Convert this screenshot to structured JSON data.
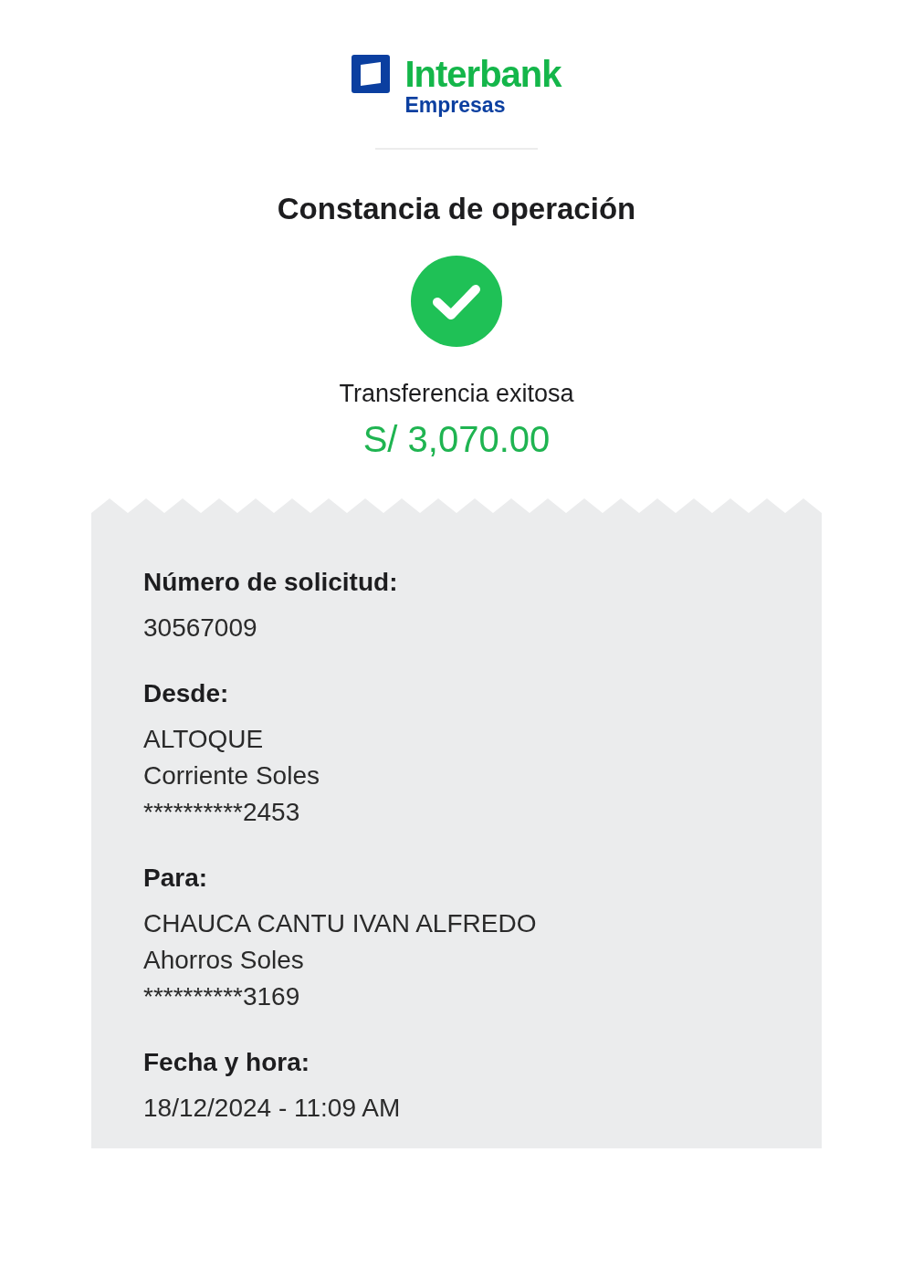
{
  "logo": {
    "brand": "Interbank",
    "subtitle": "Empresas"
  },
  "title": "Constancia de operación",
  "status": {
    "kind": "success",
    "text": "Transferencia exitosa"
  },
  "amount": "S/ 3,070.00",
  "details": [
    {
      "label": "Número de solicitud:",
      "lines": [
        "30567009"
      ]
    },
    {
      "label": "Desde:",
      "lines": [
        "ALTOQUE",
        "Corriente Soles",
        "**********2453"
      ]
    },
    {
      "label": "Para:",
      "lines": [
        "CHAUCA CANTU IVAN ALFREDO",
        "Ahorros Soles",
        "**********3169"
      ]
    },
    {
      "label": "Fecha y hora:",
      "lines": [
        "18/12/2024 - 11:09 AM"
      ]
    }
  ]
}
